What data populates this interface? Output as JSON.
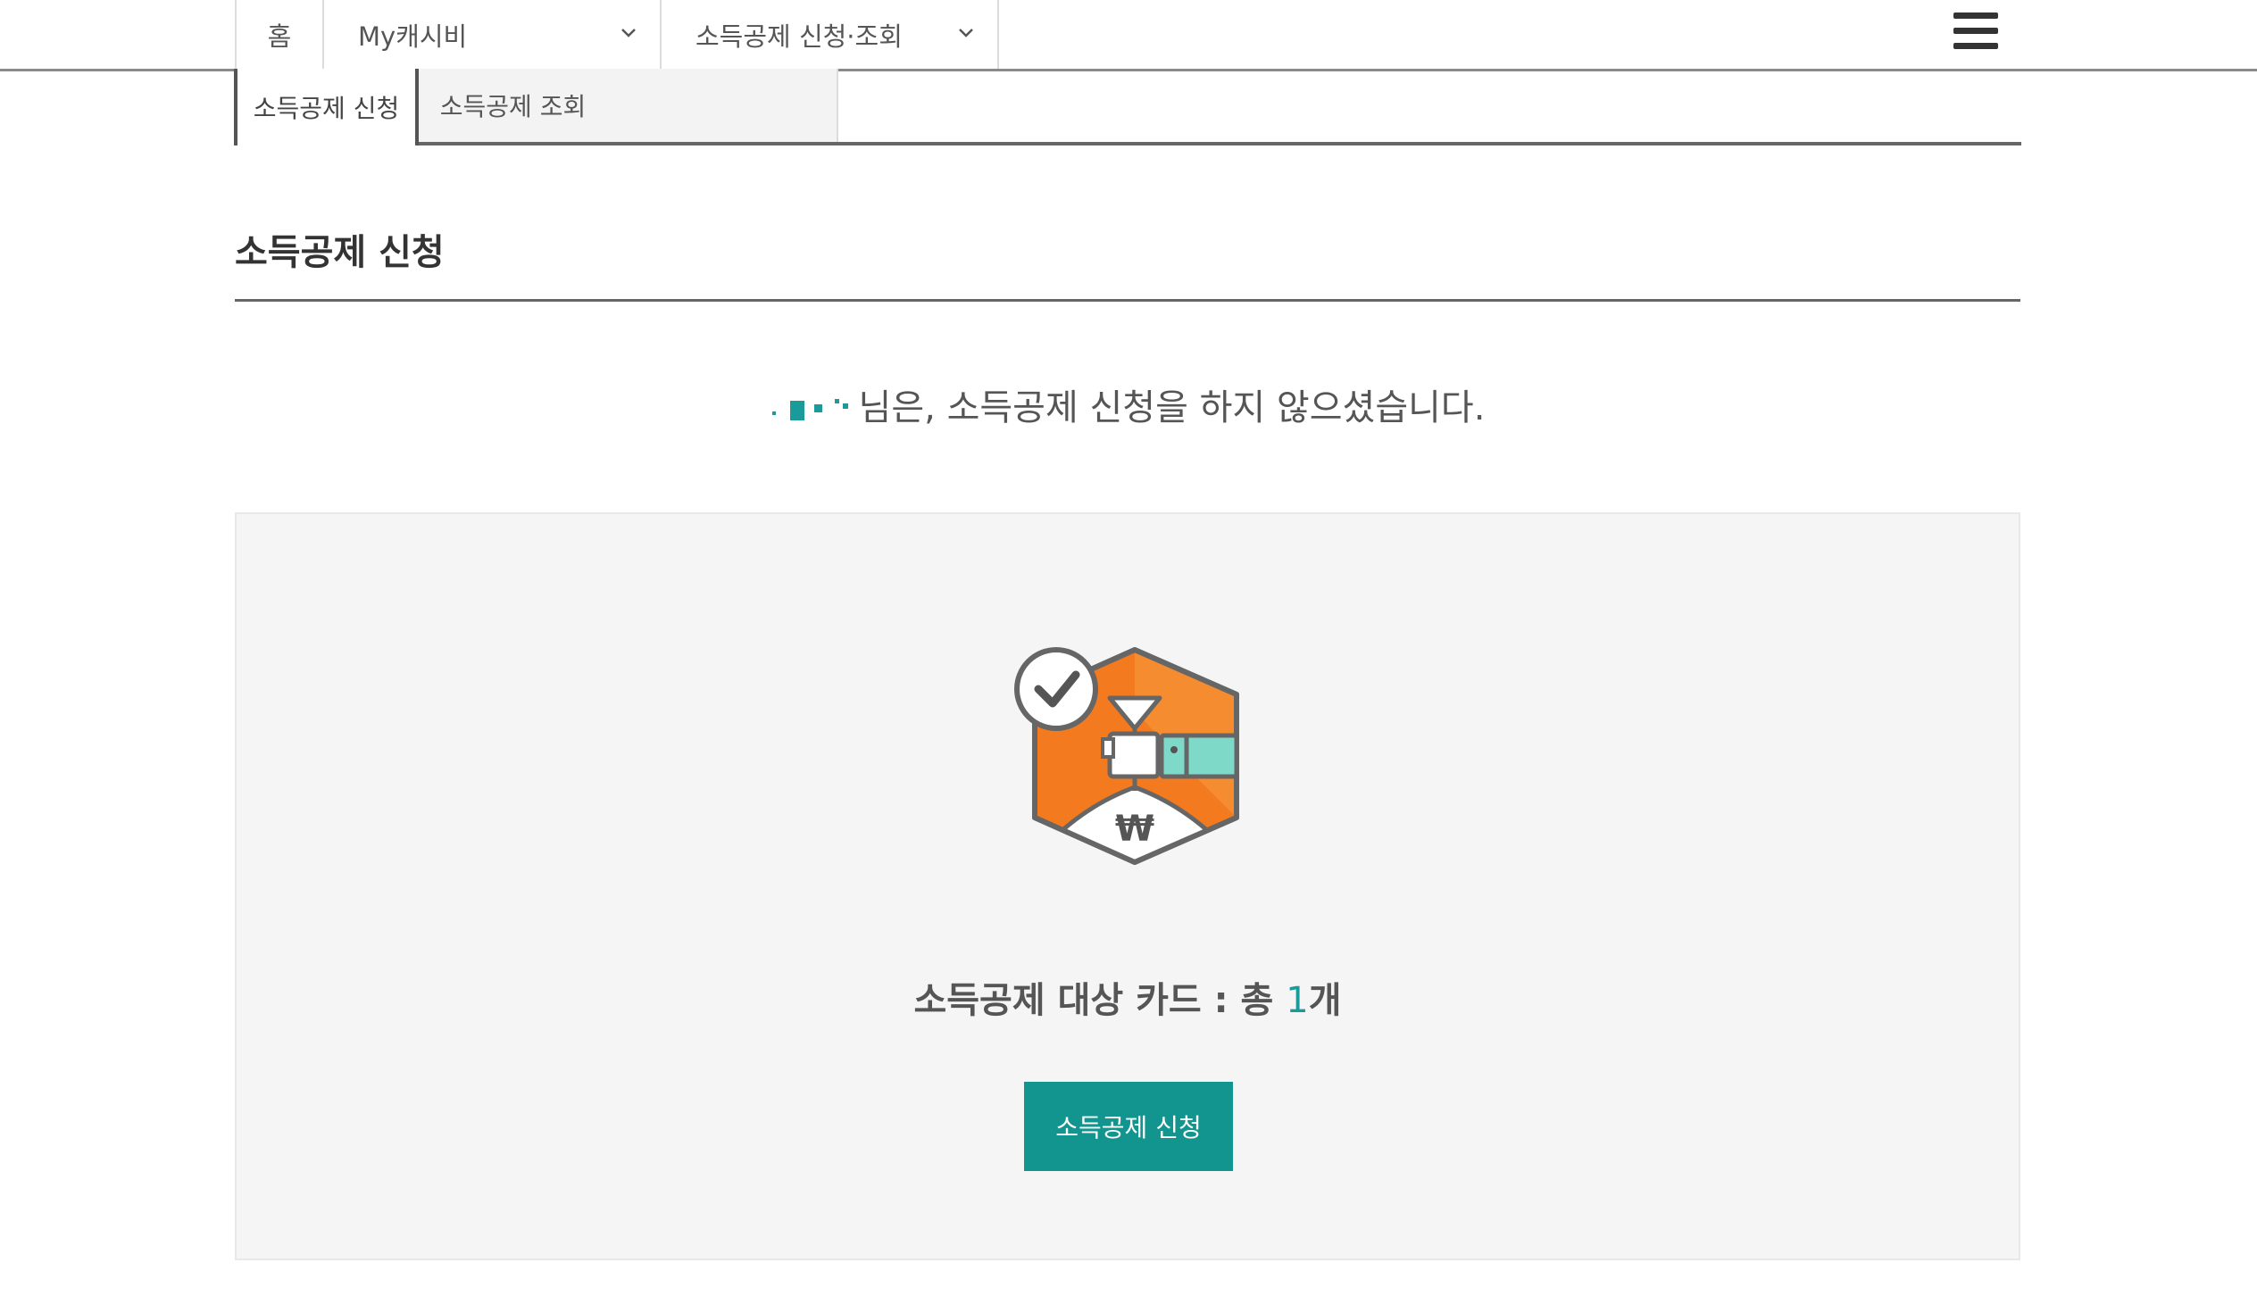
{
  "header": {
    "breadcrumb": {
      "home_label": "홈",
      "level1_label": "My캐시비",
      "level2_label": "소득공제 신청·조회"
    },
    "menu_icon": "hamburger-menu-icon"
  },
  "tabs": [
    {
      "label": "소득공제 신청",
      "active": true
    },
    {
      "label": "소득공제 조회",
      "active": false
    }
  ],
  "page": {
    "title": "소득공제 신청",
    "notice": "님은, 소득공제 신청을 하지 않으셨습니다.",
    "card_count_label": "소득공제 대상 카드 : 총 ",
    "card_count": "1",
    "card_count_unit": "개",
    "apply_button_label": "소득공제 신청",
    "illustration": "income-deduction-card-emblem",
    "emblem_currency_symbol": "₩"
  },
  "colors": {
    "accent": "#12958f",
    "emblem_orange": "#f47a1f",
    "emblem_mint": "#7fd9c9",
    "panel_bg": "#f5f5f5"
  }
}
